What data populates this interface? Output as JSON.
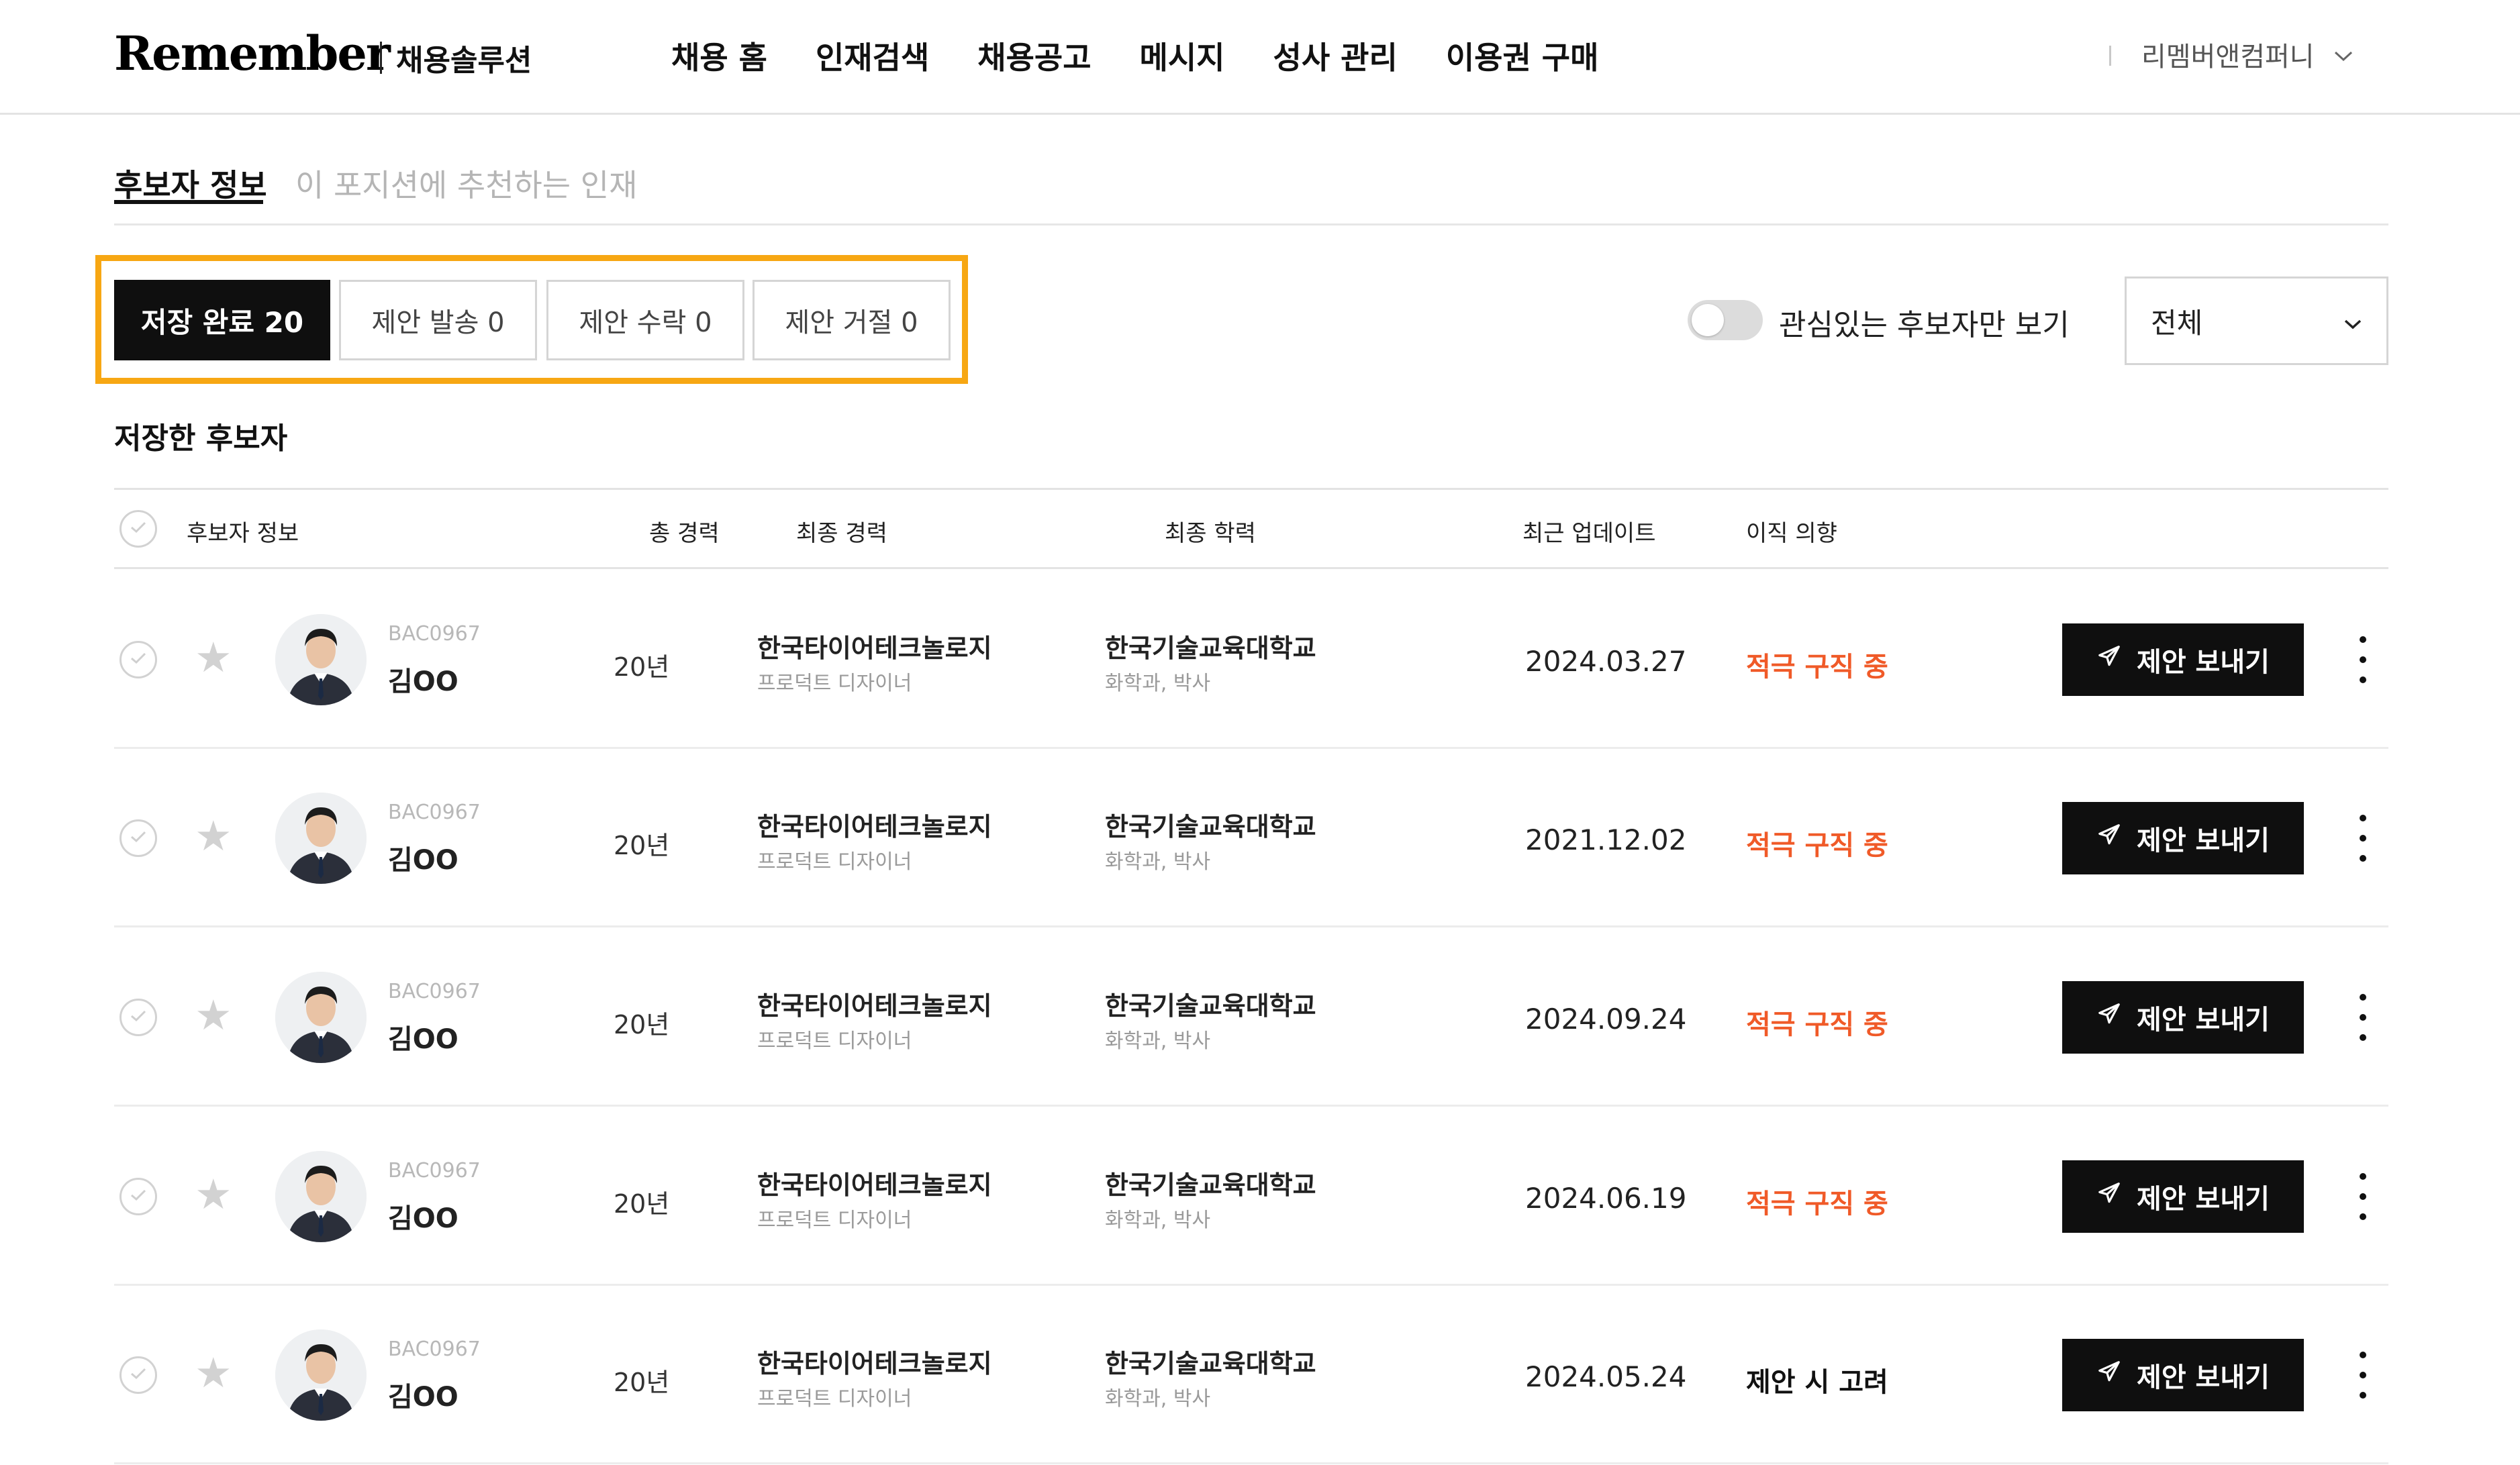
{
  "header": {
    "logo": "Remember",
    "logo_sub": "채용솔루션",
    "nav": [
      "채용 홈",
      "인재검색",
      "채용공고",
      "메시지",
      "성사 관리",
      "이용권 구매"
    ],
    "company": "리멤버앤컴퍼니"
  },
  "tabs": {
    "active": "후보자 정보",
    "inactive": "이 포지션에 추천하는 인재"
  },
  "filters": [
    "저장 완료 20",
    "제안 발송 0",
    "제안 수락 0",
    "제안 거절 0"
  ],
  "toggle_label": "관심있는 후보자만 보기",
  "select_value": "전체",
  "section_title": "저장한 후보자",
  "columns": {
    "candidate": "후보자 정보",
    "total": "총 경력",
    "last_career": "최종 경력",
    "education": "최종 학력",
    "updated": "최근 업데이트",
    "intent": "이직 의향"
  },
  "offer_label": "제안 보내기",
  "rows": [
    {
      "id": "BAC0967",
      "name": "김OO",
      "years": "20년",
      "company": "한국타이어테크놀로지",
      "role": "프로덕트 디자이너",
      "school": "한국기술교육대학교",
      "degree": "화학과, 박사",
      "date": "2024.03.27",
      "status": "적극 구직 중"
    },
    {
      "id": "BAC0967",
      "name": "김OO",
      "years": "20년",
      "company": "한국타이어테크놀로지",
      "role": "프로덕트 디자이너",
      "school": "한국기술교육대학교",
      "degree": "화학과, 박사",
      "date": "2021.12.02",
      "status": "적극 구직 중"
    },
    {
      "id": "BAC0967",
      "name": "김OO",
      "years": "20년",
      "company": "한국타이어테크놀로지",
      "role": "프로덕트 디자이너",
      "school": "한국기술교육대학교",
      "degree": "화학과, 박사",
      "date": "2024.09.24",
      "status": "적극 구직 중"
    },
    {
      "id": "BAC0967",
      "name": "김OO",
      "years": "20년",
      "company": "한국타이어테크놀로지",
      "role": "프로덕트 디자이너",
      "school": "한국기술교육대학교",
      "degree": "화학과, 박사",
      "date": "2024.06.19",
      "status": "적극 구직 중"
    },
    {
      "id": "BAC0967",
      "name": "김OO",
      "years": "20년",
      "company": "한국타이어테크놀로지",
      "role": "프로덕트 디자이너",
      "school": "한국기술교육대학교",
      "degree": "화학과, 박사",
      "date": "2024.05.24",
      "status": "제안 시 고려"
    }
  ],
  "colors": {
    "accent_orange": "#f7a713",
    "status_active": "#f05a28",
    "status_consider": "#111111",
    "primary_dark": "#0f0f0f"
  },
  "icons": {
    "check": "check-circle-icon",
    "star": "star-icon",
    "send": "send-icon",
    "more": "more-vertical-icon",
    "chevron": "chevron-down-icon"
  }
}
